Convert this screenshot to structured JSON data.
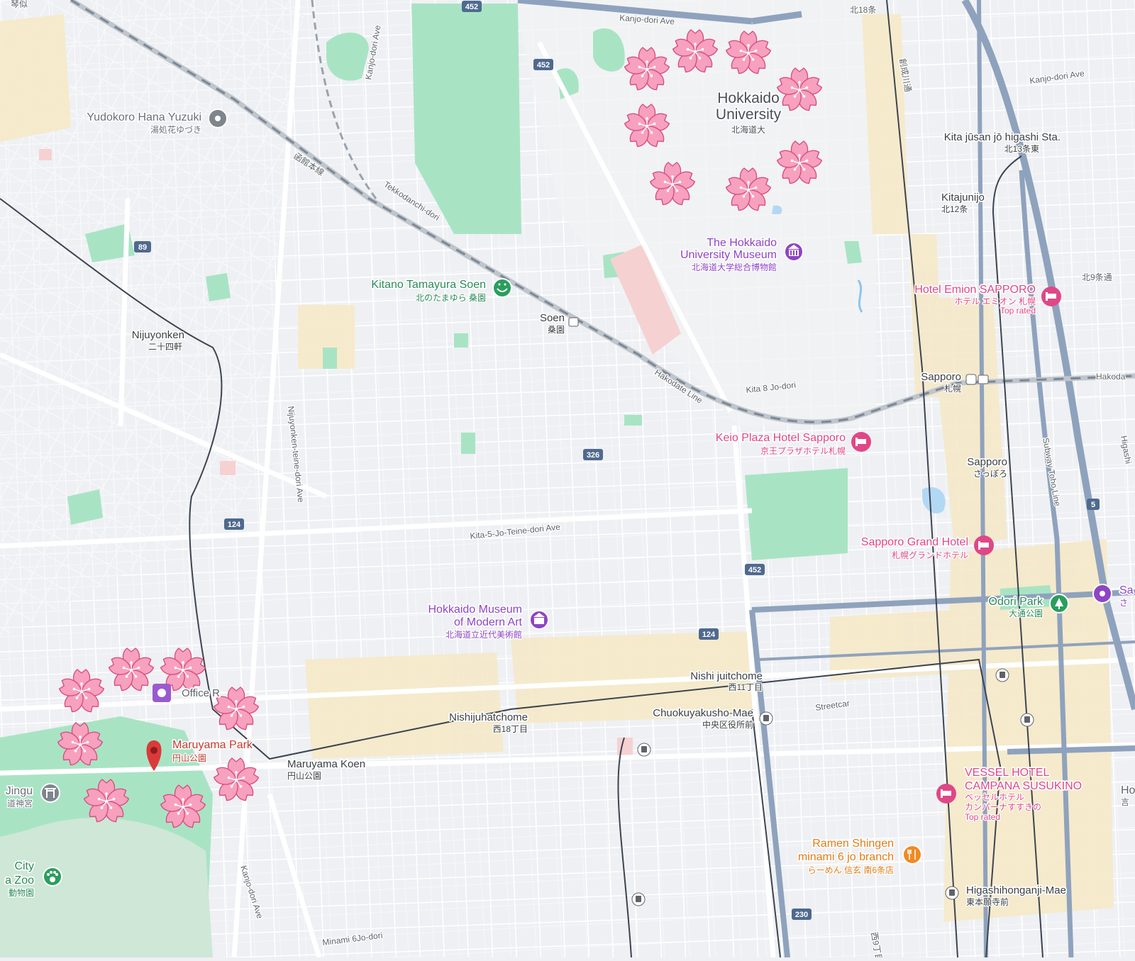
{
  "map": {
    "places": {
      "hokkaido_university": {
        "name": "Hokkaido University",
        "line1": "Hokkaido",
        "line2": "University",
        "jp": "北海道大"
      },
      "university_museum": {
        "line1": "The Hokkaido",
        "line2": "University Museum",
        "jp": "北海道大学総合博物館"
      },
      "kitano_tamayura": {
        "name": "Kitano Tamayura Soen",
        "jp": "北のたまゆら 桑園"
      },
      "yudokoro": {
        "name": "Yudokoro Hana Yuzuki",
        "jp": "湯処花ゆづき"
      },
      "hotel_emion": {
        "name": "Hotel Emion SAPPORO",
        "jp": "ホテル エミオン 札幌",
        "badge": "Top rated"
      },
      "keio_plaza": {
        "name": "Keio Plaza Hotel Sapporo",
        "jp": "京王プラザホテル札幌"
      },
      "sapporo_grand": {
        "name": "Sapporo Grand Hotel",
        "jp": "札幌グランドホテル"
      },
      "museum_modern_art": {
        "line1": "Hokkaido Museum",
        "line2": "of Modern Art",
        "jp": "北海道立近代美術館"
      },
      "maruyama_park": {
        "name": "Maruyama Park",
        "jp": "円山公園"
      },
      "odori_park": {
        "name": "Odori Park",
        "jp": "大通公園"
      },
      "vessel_hotel": {
        "line1": "VESSEL HOTEL",
        "line2": "CAMPANA SUSUKINO",
        "jp1": "ベッセルホテル",
        "jp2": "カンパーナすすきの",
        "badge": "Top rated"
      },
      "ramen_shingen": {
        "line1": "Ramen Shingen",
        "line2": "minami 6 jo branch",
        "jp": "らーめん 信玄 南6条店"
      },
      "jingu": {
        "name": "Jingu",
        "jp": "道神宮"
      },
      "city_zoo": {
        "line1": "City",
        "line2": "a Zoo",
        "jp": "動物園"
      },
      "office": {
        "name": "Office R"
      },
      "right_edge_sa": {
        "name": "Sa",
        "jp": "さ"
      },
      "right_edge_ho": {
        "name": "Ho",
        "jp": "言"
      }
    },
    "stations": {
      "sapporo_jr": {
        "name": "Sapporo",
        "jp": "札幌"
      },
      "sapporo_subway": {
        "name": "Sapporo",
        "jp": "さっぽろ"
      },
      "soen": {
        "name": "Soen",
        "jp": "桑園"
      },
      "nijuyonken": {
        "name": "Nijuyonken",
        "jp": "二十四軒"
      },
      "kita13": {
        "name": "Kita jūsan jō higashi Sta.",
        "jp": "北13条東"
      },
      "kita12": {
        "name": "Kitajunijo",
        "jp": "北12条"
      },
      "nishi11": {
        "name": "Nishi juitchome",
        "jp": "西11丁目"
      },
      "nishi18": {
        "name": "Nishijuhatchome",
        "jp": "西18丁目"
      },
      "chuokuyakusho": {
        "name": "Chuokuyakusho-Mae",
        "jp": "中央区役所前"
      },
      "maruyama_koen": {
        "name": "Maruyama Koen",
        "jp": "円山公園"
      },
      "higashihonganji": {
        "name": "Higashihonganji-Mae",
        "jp": "東本願寺前"
      }
    },
    "streets": {
      "kanjo_dori_top": "Kanjo-dori Ave",
      "kanjo_dori_vertical": "Kanjo-dori Ave",
      "kanjo_dori_right": "Kanjo-dori Ave",
      "kanjo_dori_bottom": "Kanjo-dori Ave",
      "tekkodanchi": "Tekkodanchi-dori",
      "hakodate_line": "Hakodate Line",
      "hakodate_line_jp": "函館本線",
      "hakodate_edge": "Hakoda",
      "kita8": "Kita 8 Jo-dori",
      "kita5": "Kita-5-Jo-Teine-dori Ave",
      "nijuyonken_teine": "Nijuyonken-teine-dori Ave",
      "streetcar": "Streetcar",
      "minami6": "Minami 6Jo-dori",
      "subway_toho": "Subway Toho Line",
      "higashi_edge": "Higashi",
      "kita18": "北18条",
      "kita9": "北9条通",
      "mukai": "創成川通",
      "nishi_bottom": "西9丁目",
      "top_left": "琴似"
    },
    "route_shields": [
      "452",
      "452",
      "89",
      "326",
      "124",
      "452",
      "124",
      "5",
      "230"
    ]
  }
}
